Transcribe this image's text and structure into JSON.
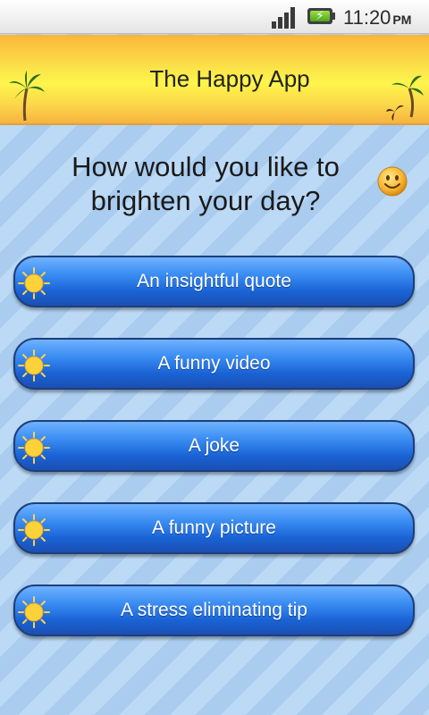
{
  "status_bar": {
    "time": "11:20",
    "ampm": "PM",
    "icons": [
      "signal-icon",
      "battery-charging-icon"
    ]
  },
  "header": {
    "title": "The Happy App",
    "decorations": [
      "palm-tree-icon",
      "palm-tree-icon"
    ]
  },
  "main": {
    "question_line1": "How would you like to",
    "question_line2": "brighten your day?",
    "question_icon": "smiley-icon",
    "options": [
      {
        "label": "An insightful quote",
        "icon": "sun-icon"
      },
      {
        "label": "A funny video",
        "icon": "sun-icon"
      },
      {
        "label": "A joke",
        "icon": "sun-icon"
      },
      {
        "label": "A funny picture",
        "icon": "sun-icon"
      },
      {
        "label": "A stress eliminating tip",
        "icon": "sun-icon"
      }
    ]
  },
  "colors": {
    "button_blue": "#1a63d6",
    "banner_yellow": "#fff54c",
    "banner_orange": "#fbb53a",
    "background_stripe_light": "#bcd9f5",
    "background_stripe_dark": "#a9ccef"
  }
}
